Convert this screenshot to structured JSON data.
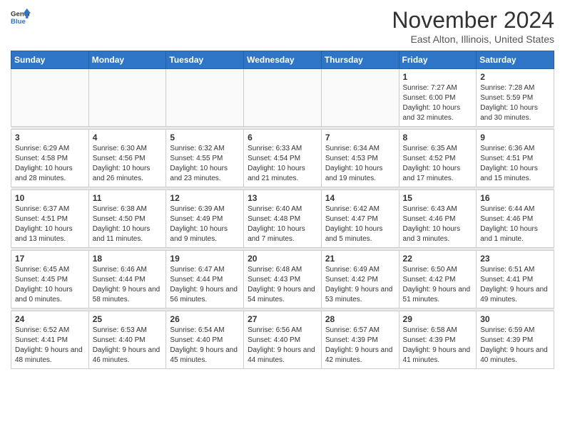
{
  "logo": {
    "line1": "General",
    "line2": "Blue"
  },
  "title": "November 2024",
  "subtitle": "East Alton, Illinois, United States",
  "weekdays": [
    "Sunday",
    "Monday",
    "Tuesday",
    "Wednesday",
    "Thursday",
    "Friday",
    "Saturday"
  ],
  "weeks": [
    [
      {
        "day": "",
        "sunrise": "",
        "sunset": "",
        "daylight": ""
      },
      {
        "day": "",
        "sunrise": "",
        "sunset": "",
        "daylight": ""
      },
      {
        "day": "",
        "sunrise": "",
        "sunset": "",
        "daylight": ""
      },
      {
        "day": "",
        "sunrise": "",
        "sunset": "",
        "daylight": ""
      },
      {
        "day": "",
        "sunrise": "",
        "sunset": "",
        "daylight": ""
      },
      {
        "day": "1",
        "sunrise": "Sunrise: 7:27 AM",
        "sunset": "Sunset: 6:00 PM",
        "daylight": "Daylight: 10 hours and 32 minutes."
      },
      {
        "day": "2",
        "sunrise": "Sunrise: 7:28 AM",
        "sunset": "Sunset: 5:59 PM",
        "daylight": "Daylight: 10 hours and 30 minutes."
      }
    ],
    [
      {
        "day": "3",
        "sunrise": "Sunrise: 6:29 AM",
        "sunset": "Sunset: 4:58 PM",
        "daylight": "Daylight: 10 hours and 28 minutes."
      },
      {
        "day": "4",
        "sunrise": "Sunrise: 6:30 AM",
        "sunset": "Sunset: 4:56 PM",
        "daylight": "Daylight: 10 hours and 26 minutes."
      },
      {
        "day": "5",
        "sunrise": "Sunrise: 6:32 AM",
        "sunset": "Sunset: 4:55 PM",
        "daylight": "Daylight: 10 hours and 23 minutes."
      },
      {
        "day": "6",
        "sunrise": "Sunrise: 6:33 AM",
        "sunset": "Sunset: 4:54 PM",
        "daylight": "Daylight: 10 hours and 21 minutes."
      },
      {
        "day": "7",
        "sunrise": "Sunrise: 6:34 AM",
        "sunset": "Sunset: 4:53 PM",
        "daylight": "Daylight: 10 hours and 19 minutes."
      },
      {
        "day": "8",
        "sunrise": "Sunrise: 6:35 AM",
        "sunset": "Sunset: 4:52 PM",
        "daylight": "Daylight: 10 hours and 17 minutes."
      },
      {
        "day": "9",
        "sunrise": "Sunrise: 6:36 AM",
        "sunset": "Sunset: 4:51 PM",
        "daylight": "Daylight: 10 hours and 15 minutes."
      }
    ],
    [
      {
        "day": "10",
        "sunrise": "Sunrise: 6:37 AM",
        "sunset": "Sunset: 4:51 PM",
        "daylight": "Daylight: 10 hours and 13 minutes."
      },
      {
        "day": "11",
        "sunrise": "Sunrise: 6:38 AM",
        "sunset": "Sunset: 4:50 PM",
        "daylight": "Daylight: 10 hours and 11 minutes."
      },
      {
        "day": "12",
        "sunrise": "Sunrise: 6:39 AM",
        "sunset": "Sunset: 4:49 PM",
        "daylight": "Daylight: 10 hours and 9 minutes."
      },
      {
        "day": "13",
        "sunrise": "Sunrise: 6:40 AM",
        "sunset": "Sunset: 4:48 PM",
        "daylight": "Daylight: 10 hours and 7 minutes."
      },
      {
        "day": "14",
        "sunrise": "Sunrise: 6:42 AM",
        "sunset": "Sunset: 4:47 PM",
        "daylight": "Daylight: 10 hours and 5 minutes."
      },
      {
        "day": "15",
        "sunrise": "Sunrise: 6:43 AM",
        "sunset": "Sunset: 4:46 PM",
        "daylight": "Daylight: 10 hours and 3 minutes."
      },
      {
        "day": "16",
        "sunrise": "Sunrise: 6:44 AM",
        "sunset": "Sunset: 4:46 PM",
        "daylight": "Daylight: 10 hours and 1 minute."
      }
    ],
    [
      {
        "day": "17",
        "sunrise": "Sunrise: 6:45 AM",
        "sunset": "Sunset: 4:45 PM",
        "daylight": "Daylight: 10 hours and 0 minutes."
      },
      {
        "day": "18",
        "sunrise": "Sunrise: 6:46 AM",
        "sunset": "Sunset: 4:44 PM",
        "daylight": "Daylight: 9 hours and 58 minutes."
      },
      {
        "day": "19",
        "sunrise": "Sunrise: 6:47 AM",
        "sunset": "Sunset: 4:44 PM",
        "daylight": "Daylight: 9 hours and 56 minutes."
      },
      {
        "day": "20",
        "sunrise": "Sunrise: 6:48 AM",
        "sunset": "Sunset: 4:43 PM",
        "daylight": "Daylight: 9 hours and 54 minutes."
      },
      {
        "day": "21",
        "sunrise": "Sunrise: 6:49 AM",
        "sunset": "Sunset: 4:42 PM",
        "daylight": "Daylight: 9 hours and 53 minutes."
      },
      {
        "day": "22",
        "sunrise": "Sunrise: 6:50 AM",
        "sunset": "Sunset: 4:42 PM",
        "daylight": "Daylight: 9 hours and 51 minutes."
      },
      {
        "day": "23",
        "sunrise": "Sunrise: 6:51 AM",
        "sunset": "Sunset: 4:41 PM",
        "daylight": "Daylight: 9 hours and 49 minutes."
      }
    ],
    [
      {
        "day": "24",
        "sunrise": "Sunrise: 6:52 AM",
        "sunset": "Sunset: 4:41 PM",
        "daylight": "Daylight: 9 hours and 48 minutes."
      },
      {
        "day": "25",
        "sunrise": "Sunrise: 6:53 AM",
        "sunset": "Sunset: 4:40 PM",
        "daylight": "Daylight: 9 hours and 46 minutes."
      },
      {
        "day": "26",
        "sunrise": "Sunrise: 6:54 AM",
        "sunset": "Sunset: 4:40 PM",
        "daylight": "Daylight: 9 hours and 45 minutes."
      },
      {
        "day": "27",
        "sunrise": "Sunrise: 6:56 AM",
        "sunset": "Sunset: 4:40 PM",
        "daylight": "Daylight: 9 hours and 44 minutes."
      },
      {
        "day": "28",
        "sunrise": "Sunrise: 6:57 AM",
        "sunset": "Sunset: 4:39 PM",
        "daylight": "Daylight: 9 hours and 42 minutes."
      },
      {
        "day": "29",
        "sunrise": "Sunrise: 6:58 AM",
        "sunset": "Sunset: 4:39 PM",
        "daylight": "Daylight: 9 hours and 41 minutes."
      },
      {
        "day": "30",
        "sunrise": "Sunrise: 6:59 AM",
        "sunset": "Sunset: 4:39 PM",
        "daylight": "Daylight: 9 hours and 40 minutes."
      }
    ]
  ]
}
